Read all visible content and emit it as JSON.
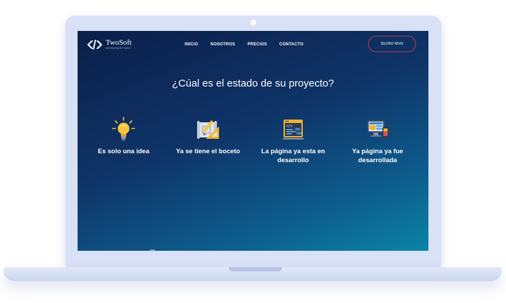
{
  "brand": {
    "name": "TwoSoft",
    "tagline": "developing the future"
  },
  "nav": {
    "items": [
      {
        "label": "INICIO"
      },
      {
        "label": "NOSOTROS"
      },
      {
        "label": "PRECIOS"
      },
      {
        "label": "CONTACTO"
      }
    ],
    "price_label": "$12350 MXN"
  },
  "main": {
    "headline": "¿Cúal es el estado de su proyecto?",
    "options": [
      {
        "label": "Es solo una idea",
        "icon": "lightbulb-icon"
      },
      {
        "label": "Ya se tiene el boceto",
        "icon": "sketch-icon"
      },
      {
        "label": "La página ya esta en desarrollo",
        "icon": "code-window-icon"
      },
      {
        "label": "Ya página ya fue desarrollada",
        "icon": "devices-icon"
      }
    ]
  },
  "colors": {
    "accent_border": "#c0394b",
    "screen_top": "#0b1f4a",
    "screen_bottom": "#0a84a6",
    "device_frame": "#d8e1f6"
  }
}
